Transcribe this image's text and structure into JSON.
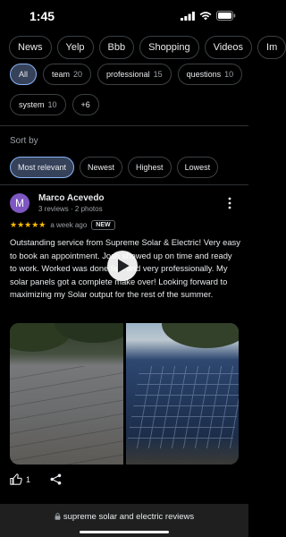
{
  "status_bar": {
    "time": "1:45",
    "icons": [
      "cellular-signal-icon",
      "wifi-icon",
      "battery-icon"
    ]
  },
  "top_chips": [
    "News",
    "Yelp",
    "Bbb",
    "Shopping",
    "Videos",
    "Im"
  ],
  "filter_chips": [
    {
      "label": "All",
      "count": "",
      "selected": true
    },
    {
      "label": "team",
      "count": "20"
    },
    {
      "label": "professional",
      "count": "15"
    },
    {
      "label": "questions",
      "count": "10"
    },
    {
      "label": "system",
      "count": "10"
    },
    {
      "label": "+6",
      "count": ""
    }
  ],
  "sort": {
    "label": "Sort by",
    "options": [
      "Most relevant",
      "Newest",
      "Highest",
      "Lowest"
    ],
    "selected": "Most relevant"
  },
  "review": {
    "avatar_letter": "M",
    "avatar_color": "#7e57c2",
    "name": "Marco Acevedo",
    "meta": "3 reviews · 2 photos",
    "stars": "★★★★★",
    "rating": 5,
    "age": "a week ago",
    "badge": "NEW",
    "text": "Outstanding service from Supreme Solar & Electric! Very easy to book an appointment. Josh showed up on time and ready to work. Worked was done fast and very professionally. My solar panels got a complete make over! Looking forward to maximizing my Solar output for the rest of the summer.",
    "likes": "1"
  },
  "browser": {
    "url": "supreme solar and electric reviews"
  },
  "colors": {
    "background": "#000000",
    "star": "#fbbc04",
    "selected_chip": "#36425a",
    "selected_border": "#8ab4f8"
  }
}
